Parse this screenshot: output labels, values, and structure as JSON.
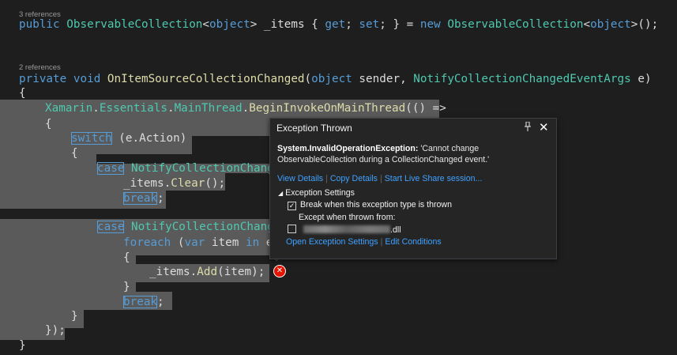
{
  "code": {
    "refs_items": "3 references",
    "line_items": {
      "kw_public": "public",
      "t_coll": "ObservableCollection",
      "lt": "<",
      "kw_object": "object",
      "gt_name": "> _items { ",
      "kw_get": "get",
      "semi_sp": "; ",
      "kw_set": "set",
      "rest": "; } = ",
      "kw_new": "new",
      "sp": " ",
      "t_coll2": "ObservableCollection",
      "lt2": "<",
      "kw_object2": "object",
      "end": ">();"
    },
    "refs_handler": "2 references",
    "line_handler": {
      "kw_private": "private",
      "kw_void": "void",
      "name": "OnItemSourceCollectionChanged",
      "paren": "(",
      "kw_object": "object",
      "sender": " sender, ",
      "t_args": "NotifyCollectionChangedEventArgs",
      "e": " e)"
    },
    "brace_open": "{",
    "line_invoke": {
      "t1": "Xamarin",
      "d1": ".",
      "t2": "Essentials",
      "d2": ".",
      "t3": "MainThread",
      "d3": ".",
      "m": "BeginInvokeOnMainThread",
      "rest": "(() =>"
    },
    "brace2": "{",
    "line_switch": {
      "kw": "switch",
      "rest": " (e.Action)"
    },
    "brace3": "{",
    "line_case1": {
      "kw": "case",
      "t": "NotifyCollectionChange"
    },
    "line_clear": {
      "a": "_items.",
      "m": "Clear",
      "b": "();"
    },
    "line_break1": {
      "kw": "break",
      "b": ";"
    },
    "line_case2": {
      "kw": "case",
      "t": "NotifyCollectionChange"
    },
    "line_foreach": {
      "kw1": "foreach",
      "p": " (",
      "kw2": "var",
      "item": " item ",
      "kw3": "in",
      "e": " e"
    },
    "brace4": "{",
    "line_add": {
      "a": "_items.",
      "m": "Add",
      "b": "(item);"
    },
    "brace5": "}",
    "line_break2": {
      "kw": "break",
      "b": ";"
    },
    "brace6": "}",
    "brace7": "});",
    "brace8": "}"
  },
  "popup": {
    "title": "Exception Thrown",
    "pin_icon": "pin-icon",
    "close_icon": "close-icon",
    "exception_type": "System.InvalidOperationException:",
    "message": " 'Cannot change ObservableCollection during a CollectionChanged event.'",
    "links": {
      "view_details": "View Details",
      "copy_details": "Copy Details",
      "live_share": "Start Live Share session..."
    },
    "exception_settings": "Exception Settings",
    "break_when": "Break when this exception type is thrown",
    "break_checked": true,
    "except_when": "Except when thrown from:",
    "dll_suffix": ".dll",
    "open_settings": "Open Exception Settings",
    "edit_conditions": "Edit Conditions"
  },
  "error_icon": "error-icon",
  "colors": {
    "background": "#1e1e1e",
    "keyword": "#569cd6",
    "type": "#4ec9b0",
    "method": "#dcdcaa",
    "link": "#3fa2ff",
    "error": "#e51400"
  }
}
